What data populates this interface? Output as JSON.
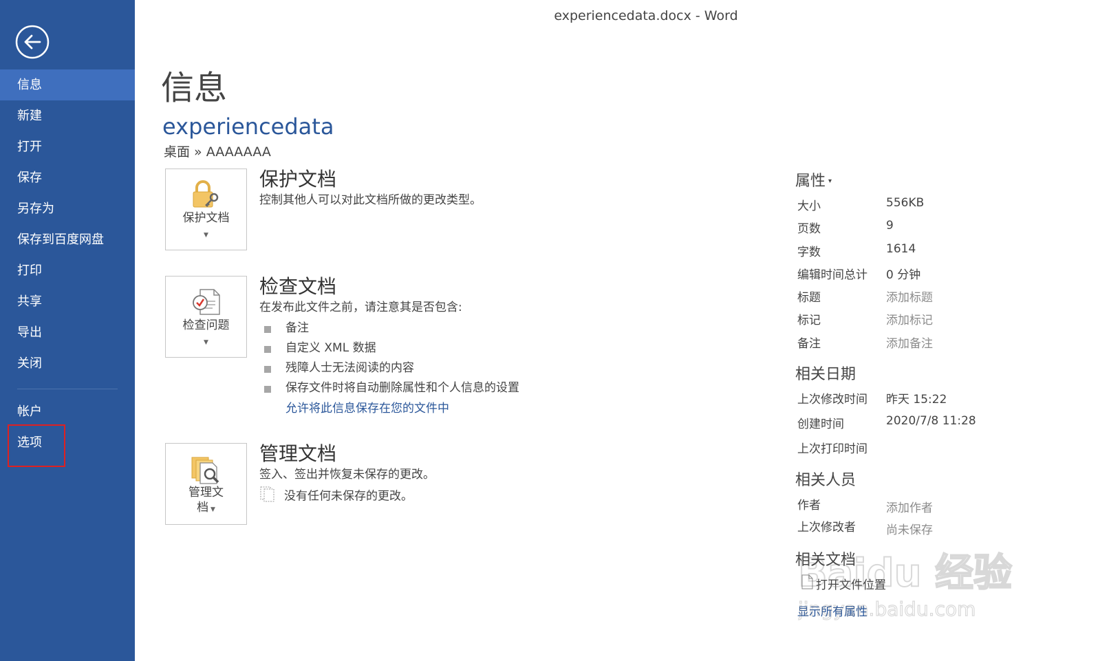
{
  "window": {
    "title": "experiencedata.docx - Word"
  },
  "sidebar": {
    "items": [
      {
        "label": "信息"
      },
      {
        "label": "新建"
      },
      {
        "label": "打开"
      },
      {
        "label": "保存"
      },
      {
        "label": "另存为"
      },
      {
        "label": "保存到百度网盘"
      },
      {
        "label": "打印"
      },
      {
        "label": "共享"
      },
      {
        "label": "导出"
      },
      {
        "label": "关闭"
      }
    ],
    "bottom_items": [
      {
        "label": "帐户"
      },
      {
        "label": "选项"
      }
    ],
    "active_item": "信息"
  },
  "main": {
    "title": "信息",
    "doc_name": "experiencedata",
    "breadcrumb": "桌面 » AAAAAAA",
    "protect": {
      "tile_label": "保护文档",
      "title": "保护文档",
      "desc": "控制其他人可以对此文档所做的更改类型。"
    },
    "inspect": {
      "tile_label": "检查问题",
      "title": "检查文档",
      "desc": "在发布此文件之前，请注意其是否包含:",
      "bullets": [
        "备注",
        "自定义 XML 数据",
        "残障人士无法阅读的内容",
        "保存文件时将自动删除属性和个人信息的设置"
      ],
      "link": "允许将此信息保存在您的文件中"
    },
    "manage": {
      "tile_label_1": "管理文",
      "tile_label_2": "档",
      "title": "管理文档",
      "desc": "签入、签出并恢复未保存的更改。",
      "note": "没有任何未保存的更改。"
    }
  },
  "properties": {
    "header": "属性",
    "rows": [
      {
        "key": "大小",
        "value": "556KB"
      },
      {
        "key": "页数",
        "value": "9"
      },
      {
        "key": "字数",
        "value": "1614"
      },
      {
        "key": "编辑时间总计",
        "value": "0 分钟"
      },
      {
        "key": "标题",
        "value": "添加标题"
      },
      {
        "key": "标记",
        "value": "添加标记"
      },
      {
        "key": "备注",
        "value": "添加备注"
      }
    ],
    "dates_header": "相关日期",
    "dates": [
      {
        "key": "上次修改时间",
        "value": "昨天 15:22"
      },
      {
        "key": "创建时间",
        "value": "2020/7/8 11:28"
      },
      {
        "key": "上次打印时间",
        "value": ""
      }
    ],
    "people_header": "相关人员",
    "people": [
      {
        "key": "作者",
        "value": "添加作者"
      },
      {
        "key": "上次修改者",
        "value": "尚未保存"
      }
    ],
    "docs_header": "相关文档",
    "open_location": "打开文件位置",
    "show_all": "显示所有属性"
  },
  "watermark": {
    "line1": "Baidu 经验",
    "line2": "jingyan.baidu.com"
  },
  "colors": {
    "sidebar": "#2b579a",
    "active": "#3f6fbe",
    "highlight": "#e02020",
    "link": "#2b579a"
  }
}
